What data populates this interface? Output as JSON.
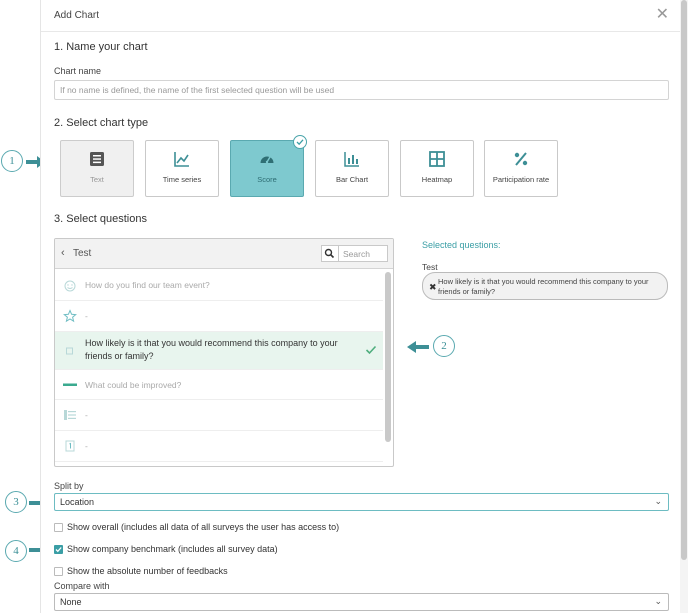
{
  "dialog": {
    "title": "Add Chart",
    "close_icon": "close-icon"
  },
  "step1": {
    "heading": "1. Name your chart",
    "field_label": "Chart name",
    "placeholder": "If no name is defined, the name of the first selected question will be used",
    "value": ""
  },
  "step2": {
    "heading": "2. Select chart type",
    "types": [
      {
        "label": "Text",
        "icon": "text-list-icon",
        "state": "disabled"
      },
      {
        "label": "Time series",
        "icon": "line-chart-icon",
        "state": "normal"
      },
      {
        "label": "Score",
        "icon": "gauge-icon",
        "state": "selected"
      },
      {
        "label": "Bar Chart",
        "icon": "bar-chart-icon",
        "state": "normal"
      },
      {
        "label": "Heatmap",
        "icon": "grid-icon",
        "state": "normal"
      },
      {
        "label": "Participation rate",
        "icon": "percent-icon",
        "state": "normal"
      }
    ]
  },
  "step3": {
    "heading": "3. Select questions",
    "breadcrumb": "Test",
    "search_placeholder": "Search",
    "questions": [
      {
        "text": "How do you find our team event?",
        "icon": "smiley-icon",
        "active": false
      },
      {
        "text": "-",
        "icon": "star-icon",
        "active": false
      },
      {
        "text": "How likely is it that you would recommend this company to your friends or family?",
        "icon": "score-icon",
        "active": true
      },
      {
        "text": "What could be improved?",
        "icon": "text-bar-icon",
        "active": false
      },
      {
        "text": "-",
        "icon": "matrix-icon",
        "active": false
      },
      {
        "text": "-",
        "icon": "number-icon",
        "active": false
      }
    ],
    "selected_title": "Selected questions:",
    "selected_group": "Test",
    "selected_items": [
      "How likely is it that you would recommend this company to your friends or family?"
    ]
  },
  "split": {
    "label": "Split by",
    "value": "Location"
  },
  "options": {
    "show_overall": "Show overall (includes all data of all surveys the user has access to)",
    "show_overall_checked": false,
    "benchmark": "Show company benchmark (includes all survey data)",
    "benchmark_checked": true,
    "absolute": "Show the absolute number of feedbacks",
    "absolute_checked": false
  },
  "compare": {
    "label": "Compare with",
    "value": "None"
  },
  "callouts": [
    "1",
    "2",
    "3",
    "4"
  ],
  "colors": {
    "accent": "#3a9ea5",
    "selected_tile": "#7ec9cf",
    "active_row": "#e8f5ee",
    "arrow": "#3d8f96"
  }
}
